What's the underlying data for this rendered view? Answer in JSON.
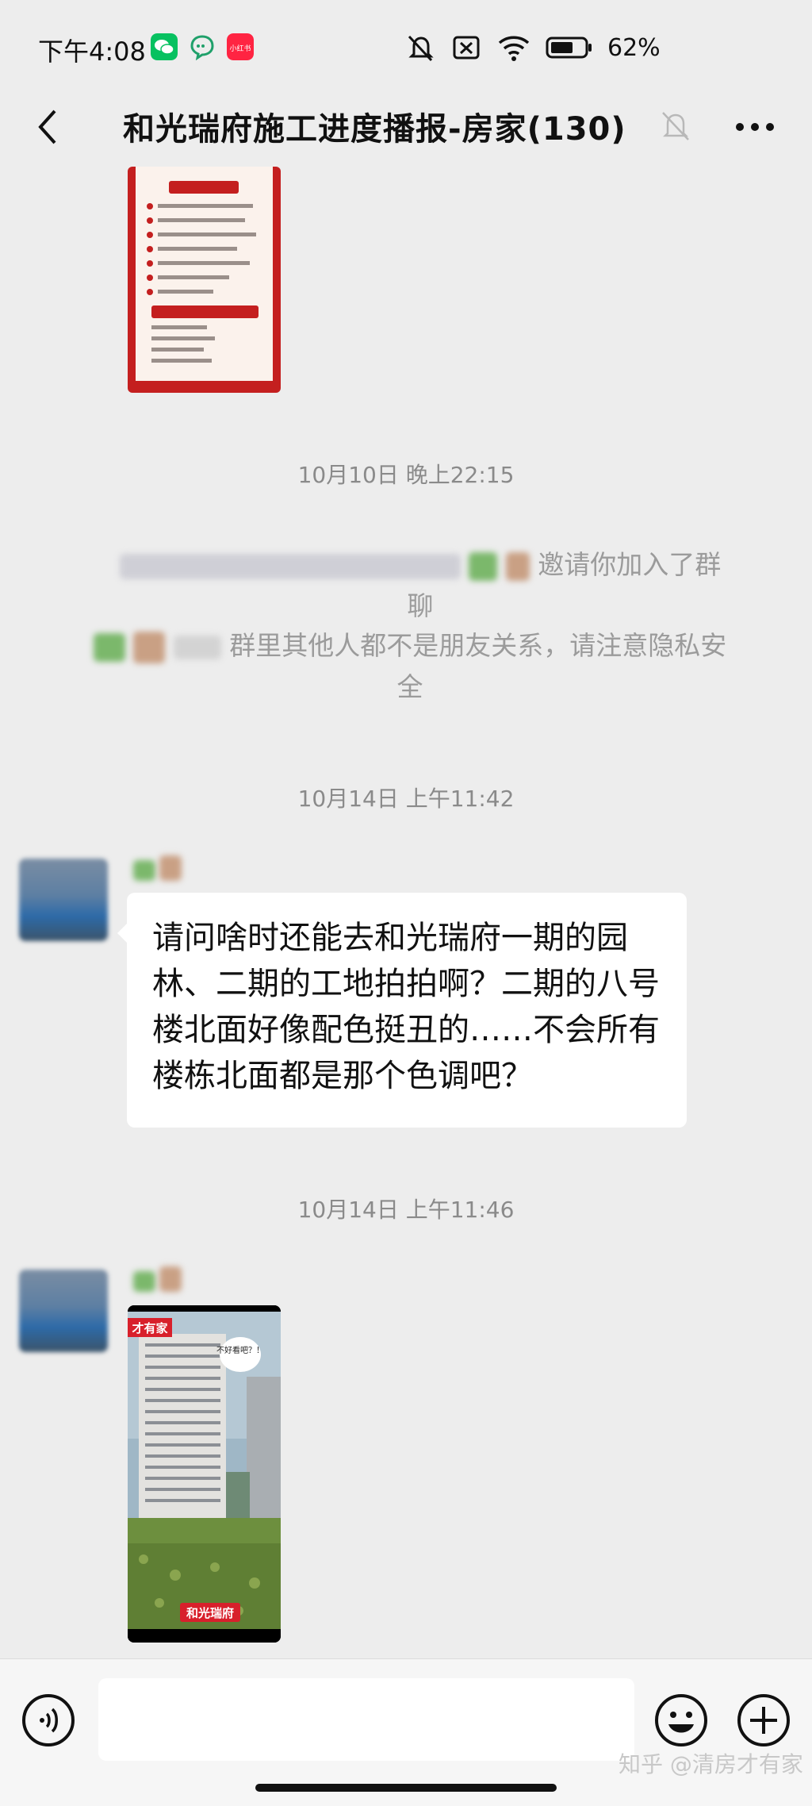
{
  "status_bar": {
    "time": "下午4:08",
    "battery": "62%",
    "app_icons": [
      "wechat-icon",
      "chat-bubble-icon",
      "xiaohongshu-icon"
    ],
    "xiaohongshu_label": "小红书"
  },
  "header": {
    "title": "和光瑞府施工进度播报-房家(130)"
  },
  "messages": {
    "ts1": "10月10日 晚上22:15",
    "sys_join": "邀请你加入了群聊",
    "sys_privacy_line1": "群里其他人都不是朋友关系，请注意隐私安",
    "sys_privacy_line2": "全",
    "ts2": "10月14日 上午11:42",
    "text_msg": "请问啥时还能去和光瑞府一期的园林、二期的工地拍拍啊？二期的八号楼北面好像配色挺丑的……不会所有楼栋北面都是那个色调吧？",
    "ts3": "10月14日 上午11:46"
  },
  "video": {
    "top_tag": "才有家",
    "bubble_text": "不好看吧？！",
    "bottom_tag": "和光瑞府"
  },
  "input": {
    "placeholder": ""
  },
  "watermark": "知乎 @清房才有家"
}
